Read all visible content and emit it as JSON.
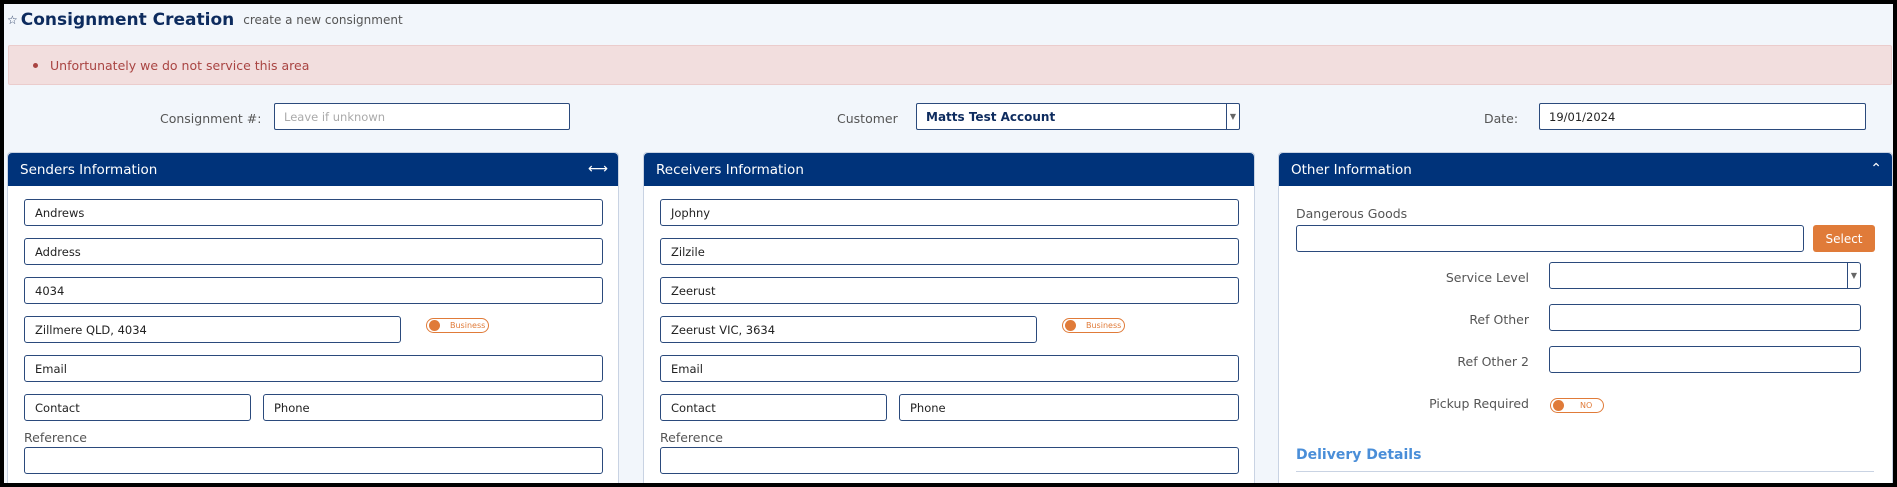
{
  "header": {
    "star_icon": "star-icon",
    "title": "Consignment Creation",
    "subtitle": "create a new consignment"
  },
  "alert": {
    "message": "Unfortunately we do not service this area"
  },
  "top_fields": {
    "consignment_label": "Consignment #:",
    "consignment_placeholder": "Leave if unknown",
    "customer_label": "Customer",
    "customer_value": "Matts Test Account",
    "date_label": "Date:",
    "date_value": "19/01/2024"
  },
  "senders": {
    "title": "Senders Information",
    "name": "Andrews",
    "address": "Address",
    "postcode": "4034",
    "suburb": "Zillmere QLD, 4034",
    "business_toggle": "Business",
    "email": "Email",
    "contact": "Contact",
    "phone": "Phone",
    "reference_label": "Reference",
    "reference_value": ""
  },
  "receivers": {
    "title": "Receivers Information",
    "name": "Jophny",
    "address": "Zilzile",
    "town": "Zeerust",
    "suburb": "Zeerust VIC, 3634",
    "business_toggle": "Business",
    "email": "Email",
    "contact": "Contact",
    "phone": "Phone",
    "reference_label": "Reference",
    "reference_value": ""
  },
  "other": {
    "title": "Other Information",
    "dangerous_goods_label": "Dangerous Goods",
    "dangerous_goods_value": "",
    "select_button": "Select",
    "service_level_label": "Service Level",
    "service_level_value": "",
    "ref_other_label": "Ref Other",
    "ref_other_value": "",
    "ref_other2_label": "Ref Other 2",
    "ref_other2_value": "",
    "pickup_required_label": "Pickup Required",
    "pickup_toggle": "NO",
    "delivery_details_title": "Delivery Details"
  },
  "colors": {
    "header_blue": "#00337a",
    "accent_orange": "#e07b39",
    "alert_bg": "#f2dede",
    "alert_text": "#a94442",
    "section_blue": "#4a8ed8"
  }
}
